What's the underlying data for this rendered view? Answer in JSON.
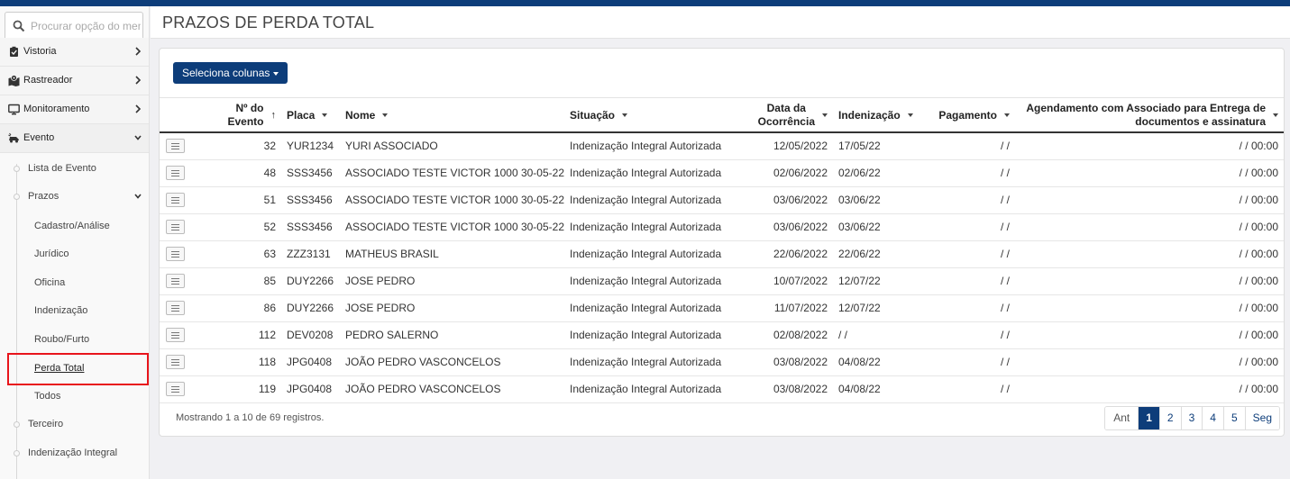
{
  "sidebar": {
    "search_placeholder": "Procurar opção do menu",
    "menu": [
      {
        "label": "Vistoria",
        "icon": "clipboard-check-icon"
      },
      {
        "label": "Rastreador",
        "icon": "map-pin-icon"
      },
      {
        "label": "Monitoramento",
        "icon": "monitor-icon"
      },
      {
        "label": "Evento",
        "icon": "car-crash-icon"
      }
    ],
    "evento_sub": [
      "Lista de Evento",
      "Prazos"
    ],
    "prazos_sub": [
      "Cadastro/Análise",
      "Jurídico",
      "Oficina",
      "Indenização",
      "Roubo/Furto",
      "Perda Total",
      "Todos"
    ],
    "evento_sub_more": [
      "Terceiro",
      "Indenização Integral"
    ]
  },
  "page": {
    "title": "PRAZOS DE PERDA TOTAL"
  },
  "toolbar": {
    "columns_button": "Seleciona colunas"
  },
  "table": {
    "headers": {
      "evento_line1": "Nº do",
      "evento_line2": "Evento",
      "evento_sort": "↑",
      "placa": "Placa",
      "nome": "Nome",
      "situacao": "Situação",
      "data_line1": "Data da",
      "data_line2": "Ocorrência",
      "indenizacao": "Indenização",
      "pagamento": "Pagamento",
      "agend_line1": "Agendamento com Associado para Entrega de",
      "agend_line2": "documentos e assinatura"
    },
    "rows": [
      {
        "evento": "32",
        "placa": "YUR1234",
        "nome": "YURI ASSOCIADO",
        "situacao": "Indenização Integral Autorizada",
        "data": "12/05/2022",
        "indenizacao": "17/05/22",
        "pagamento": "/ /",
        "agendamento": "/ / 00:00"
      },
      {
        "evento": "48",
        "placa": "SSS3456",
        "nome": "ASSOCIADO TESTE VICTOR 1000 30-05-22",
        "situacao": "Indenização Integral Autorizada",
        "data": "02/06/2022",
        "indenizacao": "02/06/22",
        "pagamento": "/ /",
        "agendamento": "/ / 00:00"
      },
      {
        "evento": "51",
        "placa": "SSS3456",
        "nome": "ASSOCIADO TESTE VICTOR 1000 30-05-22",
        "situacao": "Indenização Integral Autorizada",
        "data": "03/06/2022",
        "indenizacao": "03/06/22",
        "pagamento": "/ /",
        "agendamento": "/ / 00:00"
      },
      {
        "evento": "52",
        "placa": "SSS3456",
        "nome": "ASSOCIADO TESTE VICTOR 1000 30-05-22",
        "situacao": "Indenização Integral Autorizada",
        "data": "03/06/2022",
        "indenizacao": "03/06/22",
        "pagamento": "/ /",
        "agendamento": "/ / 00:00"
      },
      {
        "evento": "63",
        "placa": "ZZZ3131",
        "nome": "MATHEUS BRASIL",
        "situacao": "Indenização Integral Autorizada",
        "data": "22/06/2022",
        "indenizacao": "22/06/22",
        "pagamento": "/ /",
        "agendamento": "/ / 00:00"
      },
      {
        "evento": "85",
        "placa": "DUY2266",
        "nome": "JOSE PEDRO",
        "situacao": "Indenização Integral Autorizada",
        "data": "10/07/2022",
        "indenizacao": "12/07/22",
        "pagamento": "/ /",
        "agendamento": "/ / 00:00"
      },
      {
        "evento": "86",
        "placa": "DUY2266",
        "nome": "JOSE PEDRO",
        "situacao": "Indenização Integral Autorizada",
        "data": "11/07/2022",
        "indenizacao": "12/07/22",
        "pagamento": "/ /",
        "agendamento": "/ / 00:00"
      },
      {
        "evento": "112",
        "placa": "DEV0208",
        "nome": "PEDRO SALERNO",
        "situacao": "Indenização Integral Autorizada",
        "data": "02/08/2022",
        "indenizacao": "/ /",
        "pagamento": "/ /",
        "agendamento": "/ / 00:00"
      },
      {
        "evento": "118",
        "placa": "JPG0408",
        "nome": "JOÃO PEDRO VASCONCELOS",
        "situacao": "Indenização Integral Autorizada",
        "data": "03/08/2022",
        "indenizacao": "04/08/22",
        "pagamento": "/ /",
        "agendamento": "/ / 00:00"
      },
      {
        "evento": "119",
        "placa": "JPG0408",
        "nome": "JOÃO PEDRO VASCONCELOS",
        "situacao": "Indenização Integral Autorizada",
        "data": "03/08/2022",
        "indenizacao": "04/08/22",
        "pagamento": "/ /",
        "agendamento": "/ / 00:00"
      }
    ]
  },
  "footer": {
    "info": "Mostrando 1 a 10 de 69 registros.",
    "pagination": {
      "prev": "Ant",
      "pages": [
        "1",
        "2",
        "3",
        "4",
        "5"
      ],
      "next": "Seg",
      "current": "1"
    }
  },
  "colors": {
    "brand": "#0d3d7a",
    "highlight": "#e8141b"
  }
}
